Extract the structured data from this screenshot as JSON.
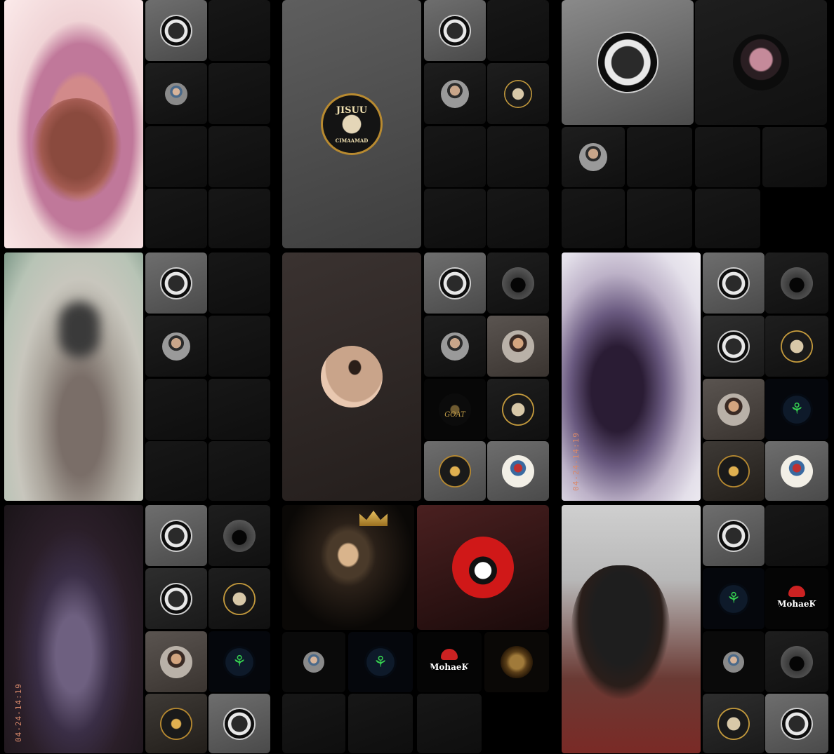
{
  "app": {
    "screen": "group video call grid"
  },
  "timestamps": {
    "video_stamp": "04-24-14:19"
  },
  "badges": {
    "jisuu_title": "JISUU",
    "jisuu_sub": "CIMAAMAD",
    "goat": "GOAT",
    "mohak": "MohaeK"
  },
  "icons": {
    "badge": "circular-logo-icon",
    "bamboo": "bamboo-icon"
  },
  "colors": {
    "background": "#000000",
    "tile_light": "#5a5a5a",
    "tile_dark": "#141414",
    "timestamp": "#d9896a"
  }
}
